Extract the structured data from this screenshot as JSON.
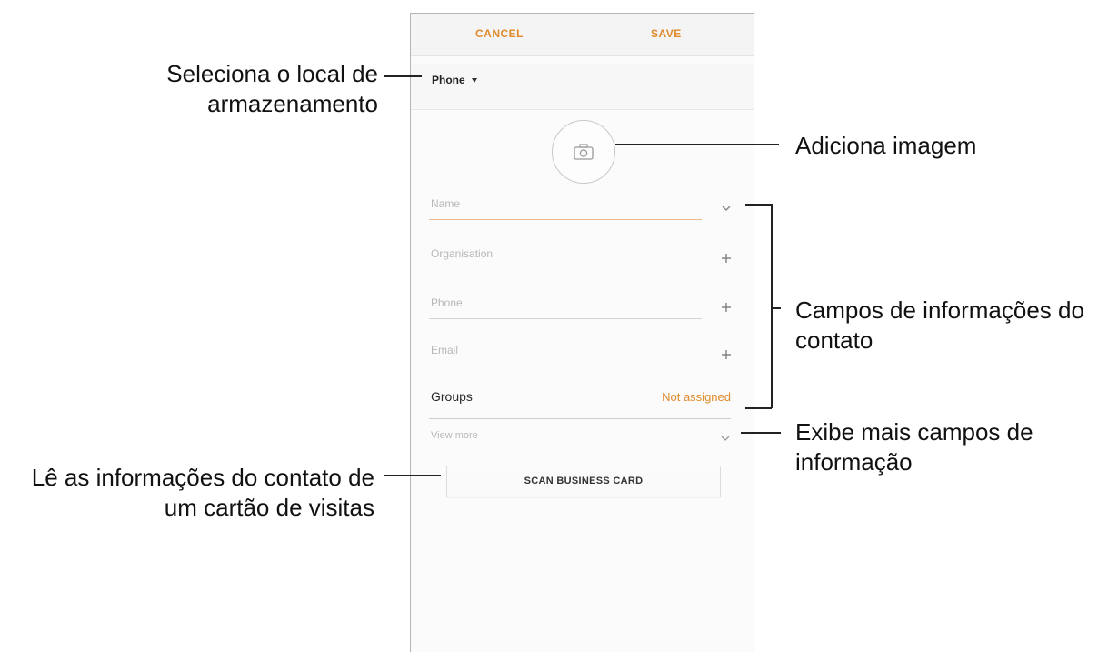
{
  "toolbar": {
    "cancel_label": "CANCEL",
    "save_label": "SAVE"
  },
  "storage": {
    "selected": "Phone"
  },
  "photo": {
    "icon": "camera-icon"
  },
  "fields": {
    "name_placeholder": "Name",
    "organisation_placeholder": "Organisation",
    "phone_placeholder": "Phone",
    "email_placeholder": "Email"
  },
  "groups": {
    "label": "Groups",
    "value": "Not assigned"
  },
  "view_more": {
    "label": "View more"
  },
  "scan": {
    "label": "SCAN BUSINESS CARD"
  },
  "annotations": {
    "storage_line1": "Seleciona o local de",
    "storage_line2": "armazenamento",
    "image": "Adiciona imagem",
    "fields_line1": "Campos de informações do",
    "fields_line2": "contato",
    "more_line1": "Exibe mais campos de",
    "more_line2": "informação",
    "scan_line1": "Lê as informações do contato de",
    "scan_line2": "um cartão de visitas"
  },
  "colors": {
    "accent": "#e08a2a"
  }
}
